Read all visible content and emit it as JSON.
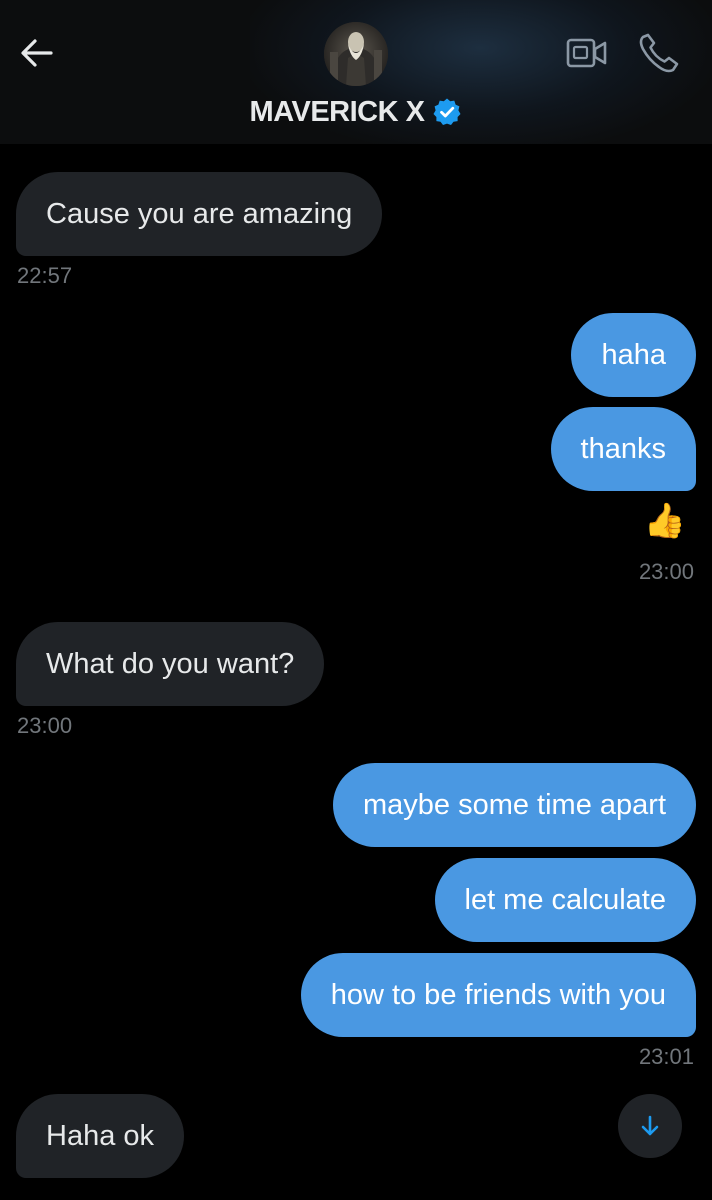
{
  "header": {
    "title": "MAVERICK X",
    "verified": true,
    "accent_color": "#1d9bf0",
    "icons": [
      "back-arrow-icon",
      "video-call-icon",
      "phone-icon",
      "verified-badge-icon"
    ]
  },
  "messages": [
    {
      "direction": "in",
      "text": "Cause you are amazing"
    },
    {
      "direction": "out",
      "text": "haha"
    },
    {
      "direction": "out",
      "text": "thanks"
    },
    {
      "direction": "in",
      "text": "What do you want?"
    },
    {
      "direction": "out",
      "text": "maybe some time apart"
    },
    {
      "direction": "out",
      "text": "let me calculate"
    },
    {
      "direction": "out",
      "text": "how to be friends with you"
    },
    {
      "direction": "in",
      "text": "Haha ok"
    }
  ],
  "timestamps": {
    "t1": "22:57",
    "t2": "23:00",
    "t3": "23:00",
    "t4": "23:01"
  },
  "reaction": "👍",
  "colors": {
    "background": "#000000",
    "incoming_bubble": "#202327",
    "outgoing_bubble": "#4a98e2",
    "timestamp": "#71767b"
  }
}
